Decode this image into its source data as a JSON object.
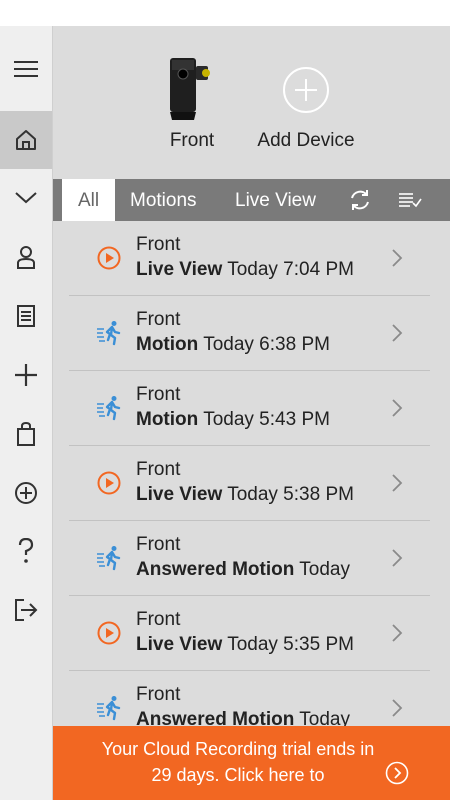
{
  "devices": [
    {
      "label": "Front",
      "icon": "camera-icon"
    },
    {
      "label": "Add Device",
      "icon": "add-circle-icon"
    }
  ],
  "tabs": [
    {
      "label": "All",
      "active": true
    },
    {
      "label": "Motions",
      "active": false
    },
    {
      "label": "Live View",
      "active": false
    }
  ],
  "tab_icons": [
    "refresh-icon",
    "filter-list-icon"
  ],
  "sidebar": {
    "items": [
      {
        "icon": "hamburger-icon"
      },
      {
        "icon": "home-icon",
        "active": true
      },
      {
        "icon": "chevron-down-icon"
      },
      {
        "icon": "user-icon"
      },
      {
        "icon": "document-icon"
      },
      {
        "icon": "plus-icon"
      },
      {
        "icon": "shopping-bag-icon"
      },
      {
        "icon": "add-circle-icon"
      },
      {
        "icon": "help-icon"
      },
      {
        "icon": "sign-out-icon"
      }
    ]
  },
  "events": [
    {
      "device": "Front",
      "type": "Live View",
      "time": "Today 7:04 PM",
      "icon": "play-circle-icon"
    },
    {
      "device": "Front",
      "type": "Motion",
      "time": "Today 6:38 PM",
      "icon": "motion-runner-icon"
    },
    {
      "device": "Front",
      "type": "Motion",
      "time": "Today 5:43 PM",
      "icon": "motion-runner-icon"
    },
    {
      "device": "Front",
      "type": "Live View",
      "time": "Today 5:38 PM",
      "icon": "play-circle-icon"
    },
    {
      "device": "Front",
      "type": "Answered Motion",
      "time": "Today",
      "icon": "motion-runner-icon"
    },
    {
      "device": "Front",
      "type": "Live View",
      "time": "Today 5:35 PM",
      "icon": "play-circle-icon"
    },
    {
      "device": "Front",
      "type": "Answered Motion",
      "time": "Today",
      "icon": "motion-runner-icon"
    }
  ],
  "banner": {
    "text": "Your Cloud Recording trial ends in 29 days. Click here to",
    "icon": "chevron-right-circle-icon"
  },
  "colors": {
    "accent": "#f26722",
    "motion_icon": "#3b8fd6",
    "live_icon": "#f26722",
    "tab_bar": "#7a7a7a"
  }
}
